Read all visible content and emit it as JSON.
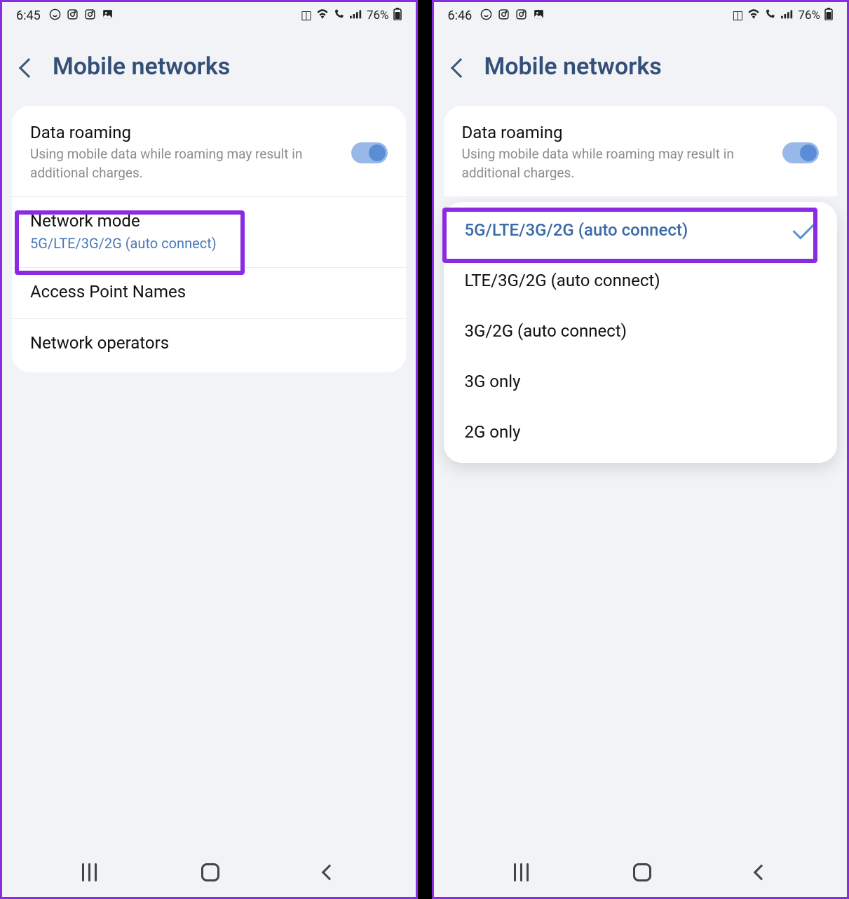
{
  "left": {
    "status": {
      "time": "6:45",
      "battery": "76%"
    },
    "header": {
      "title": "Mobile networks"
    },
    "rows": {
      "roaming": {
        "title": "Data roaming",
        "sub": "Using mobile data while roaming may result in additional charges."
      },
      "mode": {
        "title": "Network mode",
        "sub": "5G/LTE/3G/2G (auto connect)"
      },
      "apn": {
        "title": "Access Point Names"
      },
      "operators": {
        "title": "Network operators"
      }
    }
  },
  "right": {
    "status": {
      "time": "6:46",
      "battery": "76%"
    },
    "header": {
      "title": "Mobile networks"
    },
    "rows": {
      "roaming": {
        "title": "Data roaming",
        "sub": "Using mobile data while roaming may result in additional charges."
      }
    },
    "dropdown": {
      "selected": "5G/LTE/3G/2G (auto connect)",
      "opt1": "LTE/3G/2G (auto connect)",
      "opt2": "3G/2G (auto connect)",
      "opt3": "3G only",
      "opt4": "2G only"
    }
  }
}
